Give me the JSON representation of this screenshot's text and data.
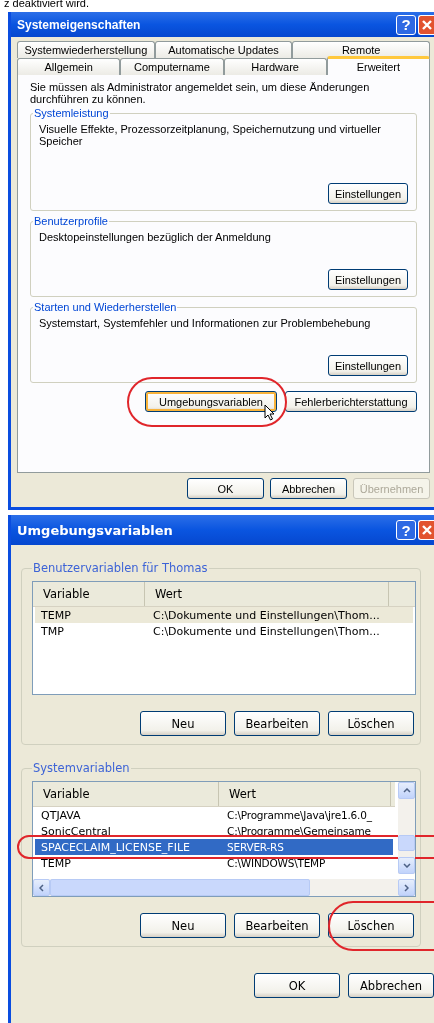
{
  "caption_fragment": "z deaktiviert wird.",
  "system_properties": {
    "title": "Systemeigenschaften",
    "help_button": "?",
    "tab_rows": [
      [
        {
          "label": "Systemwiederherstellung",
          "selected": false
        },
        {
          "label": "Automatische Updates",
          "selected": false
        },
        {
          "label": "Remote",
          "selected": false
        }
      ],
      [
        {
          "label": "Allgemein",
          "selected": false
        },
        {
          "label": "Computername",
          "selected": false
        },
        {
          "label": "Hardware",
          "selected": false
        },
        {
          "label": "Erweitert",
          "selected": true
        }
      ]
    ],
    "notice": "Sie müssen als Administrator angemeldet sein, um diese Änderungen durchführen zu können.",
    "groups": [
      {
        "title": "Systemleistung",
        "description": "Visuelle Effekte, Prozessorzeitplanung, Speichernutzung und virtueller Speicher",
        "button": "Einstellungen"
      },
      {
        "title": "Benutzerprofile",
        "description": "Desktopeinstellungen bezüglich der Anmeldung",
        "button": "Einstellungen"
      },
      {
        "title": "Starten und Wiederherstellen",
        "description": "Systemstart, Systemfehler und Informationen zur Problembehebung",
        "button": "Einstellungen"
      }
    ],
    "action_buttons": [
      {
        "label": "Umgebungsvariablen",
        "focused": true
      },
      {
        "label": "Fehlerberichterstattung",
        "focused": false
      }
    ],
    "dialog_buttons": [
      {
        "label": "OK",
        "disabled": false
      },
      {
        "label": "Abbrechen",
        "disabled": false
      },
      {
        "label": "Übernehmen",
        "disabled": true
      }
    ]
  },
  "environment_variables": {
    "title": "Umgebungsvariablen",
    "help_button": "?",
    "groups": [
      {
        "title": "Benutzervariablen für Thomas",
        "active": false,
        "columns": [
          "Variable",
          "Wert"
        ],
        "rows": [
          {
            "variable": "TEMP",
            "value": "C:\\Dokumente und Einstellungen\\Thom...",
            "selected": true
          },
          {
            "variable": "TMP",
            "value": "C:\\Dokumente und Einstellungen\\Thom...",
            "selected": false
          }
        ],
        "buttons": [
          "Neu",
          "Bearbeiten",
          "Löschen"
        ]
      },
      {
        "title": "Systemvariablen",
        "active": true,
        "columns": [
          "Variable",
          "Wert"
        ],
        "rows": [
          {
            "variable": "QTJAVA",
            "value": "C:\\Programme\\Java\\jre1.6.0_",
            "selected": false
          },
          {
            "variable": "SonicCentral",
            "value": "C:\\Programme\\Gemeinsame",
            "selected": false
          },
          {
            "variable": "SPACECLAIM_LICENSE_FILE",
            "value": "SERVER-RS",
            "selected": true
          },
          {
            "variable": "TEMP",
            "value": "C:\\WINDOWS\\TEMP",
            "selected": false
          }
        ],
        "buttons": [
          "Neu",
          "Bearbeiten",
          "Löschen"
        ]
      }
    ],
    "dialog_buttons": [
      {
        "label": "OK",
        "disabled": false
      },
      {
        "label": "Abbrechen",
        "disabled": false
      }
    ]
  }
}
